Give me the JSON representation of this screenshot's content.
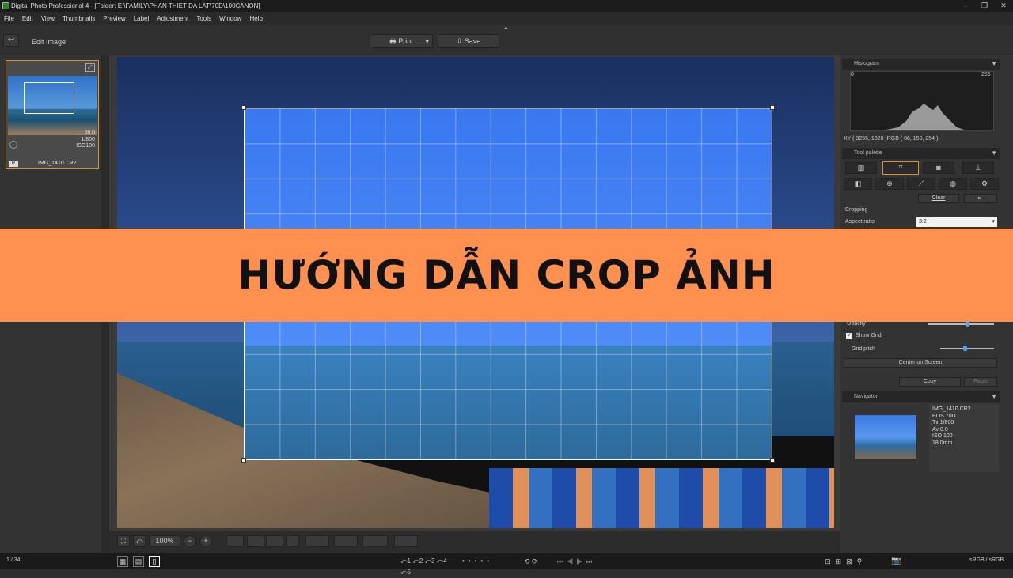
{
  "window": {
    "title": "Digital Photo Professional 4 - [Folder: E:\\FAMILY\\PHAN THIET DA LAT\\70D\\100CANON]",
    "controls": [
      "–",
      "❐",
      "✕"
    ]
  },
  "menu": [
    "File",
    "Edit",
    "View",
    "Thumbnails",
    "Preview",
    "Label",
    "Adjustment",
    "Tools",
    "Window",
    "Help"
  ],
  "toolbar": {
    "edit_image": "Edit Image",
    "print": "Print",
    "save": "Save"
  },
  "thumbnail": {
    "filename": "IMG_1410.CR2",
    "shutter": "1/800",
    "aperture": "f/8.0",
    "iso": "ISO100",
    "badge": "R"
  },
  "banner": {
    "text": "HƯỚNG DẪN CROP ẢNH"
  },
  "bottom_toolbar": {
    "zoom": "100%"
  },
  "status": {
    "count": "1 / 34",
    "color_space": "sRGB / sRGB"
  },
  "histogram": {
    "header": "Histogram",
    "min": "0",
    "max": "255",
    "readout": "XY ( 3255, 1328 )RGB ( 86, 150, 254 )"
  },
  "tool_palette": {
    "header": "Tool palette",
    "clear": "Clear",
    "cropping": "Cropping",
    "aspect_ratio_label": "Aspect ratio",
    "aspect_ratio_value": "3:2",
    "opacity": "Opacity",
    "show_grid": "Show Grid",
    "grid_pitch": "Grid pitch",
    "center_on_screen": "Center on Screen",
    "copy": "Copy",
    "paste": "Paste",
    "opacity_level": 0.6,
    "grid_pitch_level": 0.45
  },
  "navigator": {
    "header": "Navigator",
    "info": [
      "IMG_1410.CR2",
      "EOS 70D",
      "Tv 1/800",
      "Av 8.0",
      "ISO 100",
      "18.0mm"
    ]
  },
  "colors": {
    "banner": "#fe914f",
    "selection": "#e0902a"
  }
}
